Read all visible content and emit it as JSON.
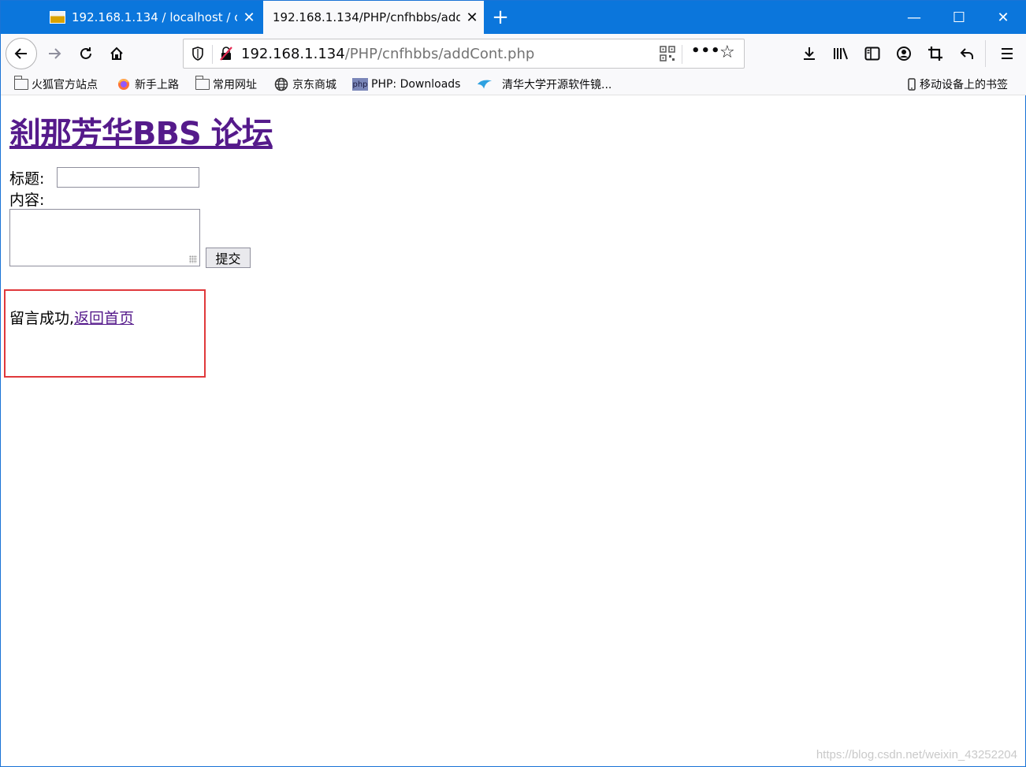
{
  "browser": {
    "tabs": [
      {
        "title": "192.168.1.134 / localhost / cnfhbbs"
      },
      {
        "title": "192.168.1.134/PHP/cnfhbbs/addCont.php"
      }
    ],
    "new_tab_label": "+",
    "window_controls": {
      "minimize": "—",
      "maximize": "☐",
      "close": "✕"
    },
    "url_host": "192.168.1.134",
    "url_path": "/PHP/cnfhbbs/addCont.php",
    "more_label": "•••",
    "accent_color": "#0b76dc"
  },
  "bookmarks": [
    {
      "label": "火狐官方站点",
      "icon": "folder-icon"
    },
    {
      "label": "新手上路",
      "icon": "firefox-icon"
    },
    {
      "label": "常用网址",
      "icon": "folder-icon"
    },
    {
      "label": "京东商城",
      "icon": "globe-icon"
    },
    {
      "label": "PHP: Downloads",
      "icon": "php-icon"
    },
    {
      "label": "清华大学开源软件镜...",
      "icon": "tuna-icon"
    }
  ],
  "mobile_bookmarks": "移动设备上的书签",
  "page": {
    "heading": "刹那芳华BBS 论坛",
    "title_label": "标题:",
    "title_value": "",
    "content_label": "内容:",
    "content_value": "",
    "submit_label": "提交",
    "success_text": "留言成功,",
    "home_link": "返回首页",
    "highlight_color": "#e0393c",
    "link_color": "#551a8b"
  },
  "watermark": "https://blog.csdn.net/weixin_43252204"
}
